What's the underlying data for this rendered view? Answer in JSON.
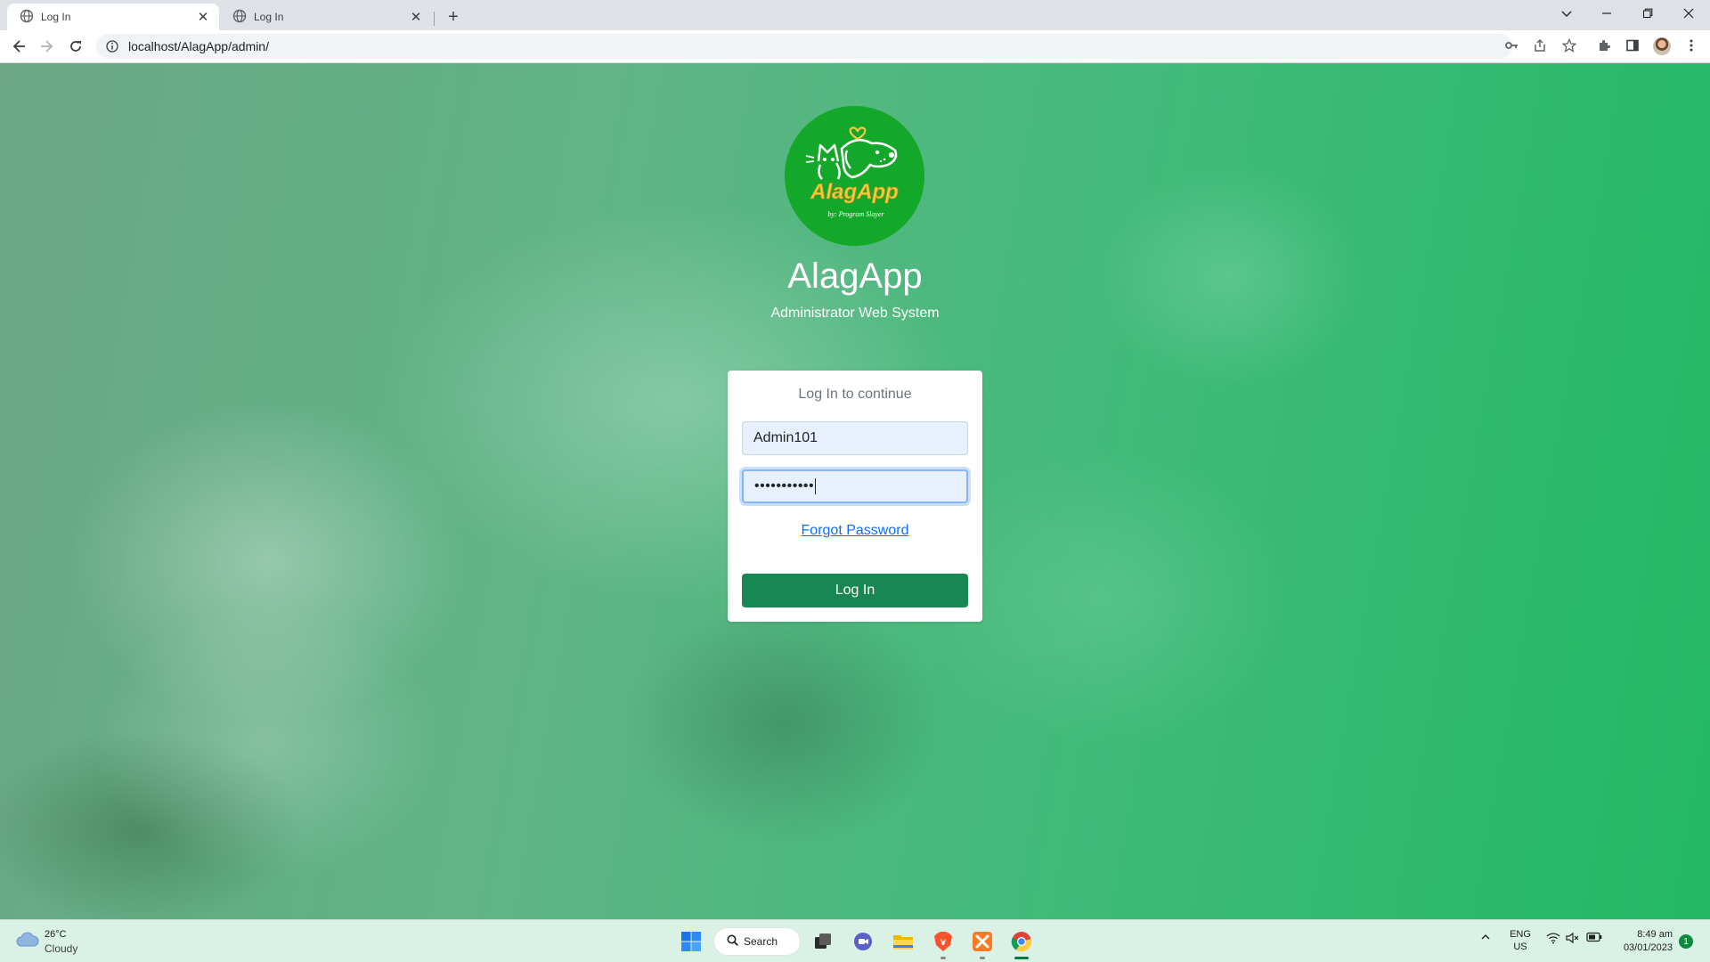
{
  "browser": {
    "tabs": [
      {
        "title": "Log In",
        "active": true
      },
      {
        "title": "Log In",
        "active": false
      }
    ],
    "new_tab_symbol": "+",
    "address_bar": {
      "url": "localhost/AlagApp/admin/"
    },
    "window_controls": [
      "minimize-icon",
      "restore-icon",
      "close-icon"
    ],
    "toolbar_icons": [
      "back-icon",
      "forward-icon",
      "reload-icon",
      "key-icon",
      "share-icon",
      "bookmark-star-icon",
      "extensions-icon",
      "side-panel-icon",
      "profile-avatar",
      "menu-icon"
    ]
  },
  "page": {
    "logo": {
      "brand_text": "AlagApp",
      "tagline": "by: Program Slayer",
      "color": "#14a82a",
      "accent": "#f5c842"
    },
    "title": "AlagApp",
    "subtitle": "Administrator Web System",
    "login_card": {
      "heading": "Log In to continue",
      "username_value": "Admin101",
      "password_mask": "•••••••••••",
      "forgot_password_link": "Forgot Password",
      "submit_label": "Log In"
    },
    "colors": {
      "button": "#198754",
      "link": "#0d6efd",
      "background_tint": "#3fbb78"
    }
  },
  "taskbar": {
    "weather": {
      "temperature": "26°C",
      "condition": "Cloudy"
    },
    "search_label": "Search",
    "apps": [
      "start-icon",
      "search",
      "task-view-icon",
      "chat-icon",
      "file-explorer-icon",
      "brave-browser-icon",
      "xampp-icon",
      "chrome-icon"
    ],
    "tray": {
      "language_line1": "ENG",
      "language_line2": "US",
      "time": "8:49 am",
      "date": "03/01/2023",
      "notification_count": "1"
    }
  }
}
